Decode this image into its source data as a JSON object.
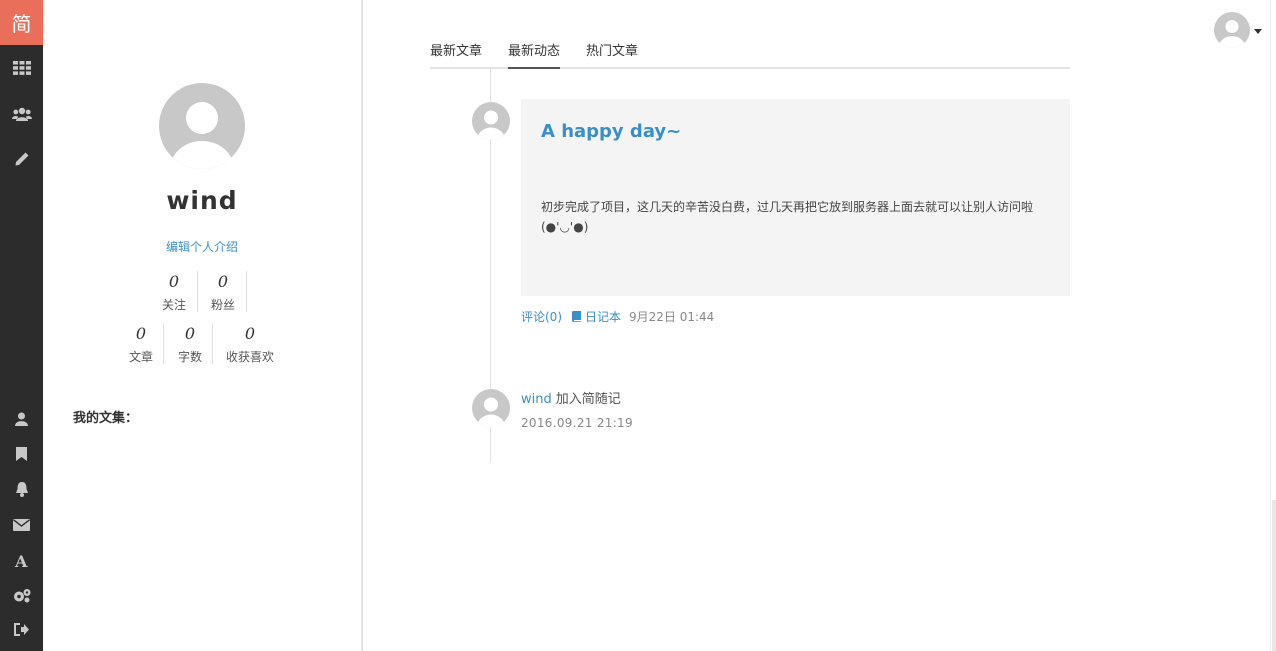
{
  "nav": {
    "logo_char": "简",
    "top_icons": [
      "apps-grid-icon",
      "users-group-icon",
      "pencil-icon"
    ],
    "bottom_icons": [
      "user-icon",
      "bookmark-icon",
      "bell-icon",
      "mail-icon",
      "font-icon",
      "settings-icon",
      "logout-icon"
    ],
    "bg_color": "#2c2c2c",
    "accent_color": "#ea6f5a"
  },
  "profile": {
    "username": "wind",
    "edit_intro": "编辑个人介绍",
    "stats_row1": [
      {
        "num": "0",
        "label": "关注"
      },
      {
        "num": "0",
        "label": "粉丝"
      }
    ],
    "stats_row2": [
      {
        "num": "0",
        "label": "文章"
      },
      {
        "num": "0",
        "label": "字数"
      },
      {
        "num": "0",
        "label": "收获喜欢"
      }
    ],
    "collections_label": "我的文集："
  },
  "tabs": [
    {
      "label": "最新文章",
      "active": false
    },
    {
      "label": "最新动态",
      "active": true
    },
    {
      "label": "热门文章",
      "active": false
    }
  ],
  "timeline": {
    "post": {
      "title": "A happy day~",
      "body": "初步完成了项目，这几天的辛苦没白费，过几天再把它放到服务器上面去就可以让别人访问啦(●'◡'●)",
      "comments": "评论(0)",
      "notebook": "日记本",
      "time": "9月22日 01:44"
    },
    "join": {
      "user": "wind",
      "action": "加入简随记",
      "time": "2016.09.21 21:19"
    }
  },
  "link_color": "#3b8fc8"
}
